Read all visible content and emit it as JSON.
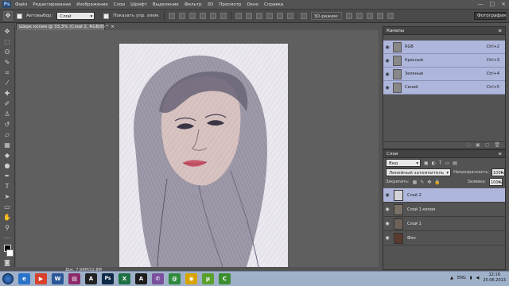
{
  "menubar": {
    "logo": "Ps",
    "items": [
      "Файл",
      "Редактирование",
      "Изображение",
      "Слои",
      "Шрифт",
      "Выделение",
      "Фильтр",
      "3D",
      "Просмотр",
      "Окно",
      "Справка"
    ],
    "window_controls": [
      "—",
      "□",
      "×"
    ]
  },
  "options": {
    "auto_select_label": "Автовыбор:",
    "auto_select_value": "Слой",
    "show_controls_label": "Показать упр. элем.",
    "mode3d_label": "3D-режим:",
    "workspace": "Фотография"
  },
  "document": {
    "tab_title": "Шерк копия @ 33,3% (Слой 2, RGB/8) *",
    "tab_close": "×",
    "status": "Док: 7,99М/32,8М"
  },
  "channels": {
    "title": "Каналы",
    "rows": [
      {
        "name": "RGB",
        "key": "Ctrl+2"
      },
      {
        "name": "Красный",
        "key": "Ctrl+3"
      },
      {
        "name": "Зеленый",
        "key": "Ctrl+4"
      },
      {
        "name": "Синий",
        "key": "Ctrl+5"
      }
    ]
  },
  "layers": {
    "title": "Слои",
    "kind": "Вид",
    "blend_mode": "Линейный затемнитель",
    "opacity_label": "Непрозрачность:",
    "opacity_value": "100%",
    "lock_label": "Закрепить:",
    "fill_label": "Заливка:",
    "fill_value": "100%",
    "rows": [
      {
        "name": "Слой 2",
        "active": true,
        "thumb_color": "#d4d4d8"
      },
      {
        "name": "Слой 1 копия",
        "active": false,
        "thumb_color": "#7a7066"
      },
      {
        "name": "Слой 1",
        "active": false,
        "thumb_color": "#6c625a"
      },
      {
        "name": "Фон",
        "active": false,
        "thumb_color": "#5a3a2e"
      }
    ]
  },
  "taskbar": {
    "apps": [
      {
        "icon": "ie-icon",
        "glyph": "e",
        "color": "#2a73c9"
      },
      {
        "icon": "media-icon",
        "glyph": "▶",
        "color": "#d9412c"
      },
      {
        "icon": "word-icon",
        "glyph": "W",
        "color": "#2b5797"
      },
      {
        "icon": "winrar-icon",
        "glyph": "▤",
        "color": "#8c2a6a"
      },
      {
        "icon": "font-icon",
        "glyph": "A",
        "color": "#222222"
      },
      {
        "icon": "photoshop-icon",
        "glyph": "Ps",
        "color": "#0e2a47"
      },
      {
        "icon": "excel-icon",
        "glyph": "X",
        "color": "#1e7145"
      },
      {
        "icon": "app-a-icon",
        "glyph": "A",
        "color": "#1d1d1d"
      },
      {
        "icon": "viber-icon",
        "glyph": "✆",
        "color": "#7b519d"
      },
      {
        "icon": "mail-icon",
        "glyph": "@",
        "color": "#2e8b3d"
      },
      {
        "icon": "chrome-icon",
        "glyph": "◉",
        "color": "#d9a400"
      },
      {
        "icon": "torrent-icon",
        "glyph": "μ",
        "color": "#5aa02c"
      },
      {
        "icon": "camtasia-icon",
        "glyph": "C",
        "color": "#3c8d2f"
      }
    ],
    "lang": "ENG",
    "time": "12:16",
    "date": "20.06.2013"
  }
}
